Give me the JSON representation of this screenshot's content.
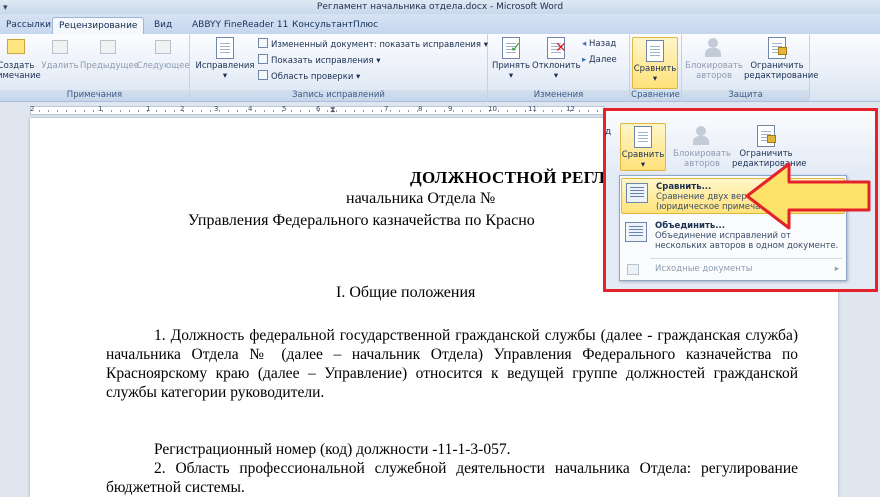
{
  "window": {
    "title": "Регламент начальника отдела.docx - Microsoft Word"
  },
  "tabs": [
    {
      "label": "Рассылки"
    },
    {
      "label": "Рецензирование",
      "active": true
    },
    {
      "label": "Вид"
    },
    {
      "label": "ABBYY FineReader 11"
    },
    {
      "label": "КонсультантПлюс"
    }
  ],
  "ribbon": {
    "groups": {
      "notes": {
        "label": "Примечания",
        "create": "Создать",
        "create2": "имечание",
        "delete": "Удалить",
        "prev": "Предыдущее",
        "next": "Следующее"
      },
      "tracking": {
        "label": "Запись исправлений",
        "corrections": "Исправления",
        "display_mode": "Измененный документ: показать исправления",
        "show_markup": "Показать исправления",
        "review_pane": "Область проверки"
      },
      "changes": {
        "label": "Изменения",
        "accept": "Принять",
        "reject": "Отклонить",
        "back": "Назад",
        "forward": "Далее"
      },
      "compare": {
        "label": "Сравнение",
        "compare": "Сравнить"
      },
      "protect": {
        "label": "Защита",
        "block": "Блокировать",
        "block2": "авторов",
        "restrict": "Ограничить",
        "restrict2": "редактирование"
      }
    }
  },
  "ruler": {
    "numbers": [
      "2",
      "1",
      "1",
      "2",
      "3",
      "4",
      "5",
      "6",
      "7",
      "8",
      "9",
      "10",
      "11",
      "12"
    ]
  },
  "document": {
    "title1": "ДОЛЖНОСТНОЙ РЕГЛАМЕНТ",
    "title2": "начальника Отдела №",
    "title3": "Управления Федерального казначейства по Красно",
    "section": "I.  Общие положения",
    "p1": "1.  Должность федеральной государственной гражданской службы (далее - гражданская служба) начальника Отдела №      (далее – начальник Отдела) Управления Федерального казначейства по Красноярскому краю (далее – Управление) относится к ведущей группе должностей гражданской службы категории руководители.",
    "p2": "Регистрационный номер (код) должности -11-1-3-057.",
    "p3": "2.  Область профессиональной служебной деятельности начальника Отдела: регулирование бюджетной системы."
  },
  "overlay": {
    "partial_letter": "д",
    "compare": "Сравнить",
    "block": "Блокировать",
    "block2": "авторов",
    "restrict": "Ограничить",
    "restrict2": "редактирование",
    "menu": {
      "item1_title": "Сравнить...",
      "item1_desc1": "Сравнение двух версий документа",
      "item1_desc2": "(юридическое примечание).",
      "item2_title": "Объединить...",
      "item2_desc1": "Объединение исправлений от",
      "item2_desc2": "нескольких авторов в одном документе.",
      "item3": "Исходные документы"
    }
  },
  "colors": {
    "highlight_border": "#e5222a",
    "arrow_fill": "#fde26a"
  }
}
